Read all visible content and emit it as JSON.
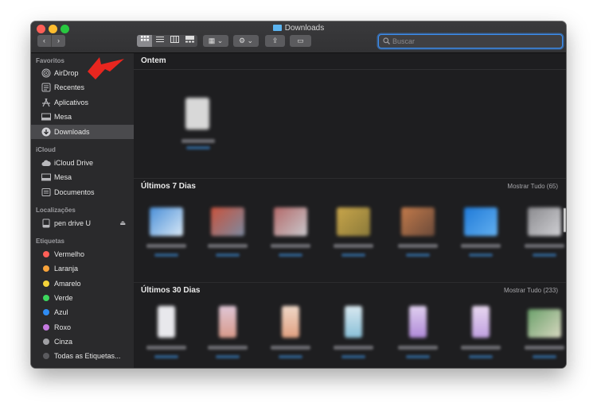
{
  "window": {
    "title": "Downloads"
  },
  "toolbar": {
    "back_glyph": "‹",
    "forward_glyph": "›",
    "view_modes": [
      "icon-view",
      "list-view",
      "column-view",
      "gallery-view"
    ],
    "group_glyph": "▦ ⌄",
    "action_glyph": "⚙ ⌄",
    "share_glyph": "⇪",
    "tag_glyph": "▭"
  },
  "search": {
    "placeholder": "Buscar"
  },
  "sidebar": {
    "favoritos_header": "Favoritos",
    "favoritos": [
      {
        "label": "AirDrop",
        "icon": "airdrop-icon"
      },
      {
        "label": "Recentes",
        "icon": "recents-icon"
      },
      {
        "label": "Aplicativos",
        "icon": "applications-icon"
      },
      {
        "label": "Mesa",
        "icon": "desktop-icon"
      },
      {
        "label": "Downloads",
        "icon": "downloads-icon",
        "selected": true
      }
    ],
    "icloud_header": "iCloud",
    "icloud": [
      {
        "label": "iCloud Drive",
        "icon": "cloud-icon"
      },
      {
        "label": "Mesa",
        "icon": "desktop-icon"
      },
      {
        "label": "Documentos",
        "icon": "documents-icon"
      }
    ],
    "locations_header": "Localizações",
    "locations": [
      {
        "label": "pen drive U",
        "icon": "drive-icon"
      }
    ],
    "tags_header": "Etiquetas",
    "tags": [
      {
        "label": "Vermelho",
        "color": "#fe5f57"
      },
      {
        "label": "Laranja",
        "color": "#f7a33b"
      },
      {
        "label": "Amarelo",
        "color": "#f5d33a"
      },
      {
        "label": "Verde",
        "color": "#3dd65d"
      },
      {
        "label": "Azul",
        "color": "#2f8cf3"
      },
      {
        "label": "Roxo",
        "color": "#c57ae0"
      },
      {
        "label": "Cinza",
        "color": "#a0a0a4"
      },
      {
        "label": "Todas as Etiquetas...",
        "color": "#5a5a5e"
      }
    ]
  },
  "sections": {
    "ontem": {
      "title": "Ontem"
    },
    "ultimos7": {
      "title": "Últimos 7 Dias",
      "link": "Mostrar Tudo (65)"
    },
    "ultimos30": {
      "title": "Últimos 30 Dias",
      "link": "Mostrar Tudo (233)"
    }
  },
  "colors": {
    "accent": "#3c8ef0",
    "selection": "#4a4a4d",
    "annotation_arrow": "#e8261f"
  }
}
